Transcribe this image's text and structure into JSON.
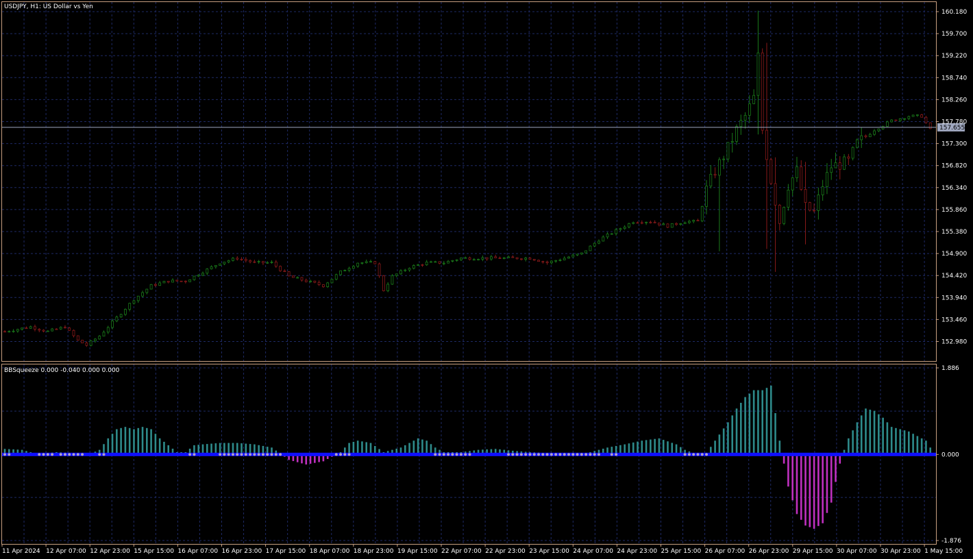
{
  "window": {
    "symbol_title": "USDJPY, H1:  US Dollar vs Yen",
    "indicator_title": "BBSqueeze 0.000 -0.040 0.000 0.000"
  },
  "colors": {
    "background": "#000000",
    "frame": "#c8a080",
    "grid": "#1e2a66",
    "bull": "#1a7a1a",
    "bear": "#8a1a1a",
    "price_line": "#a0a8c0",
    "price_label_bg": "#a0a8c0",
    "hist_pos": "#2e8b8b",
    "hist_neg": "#c030c0",
    "zero_line": "#1010ff",
    "squeeze_dot": "#b0a0c8"
  },
  "chart_data": {
    "type": "candlestick",
    "price_axis": {
      "ticks": [
        "160.180",
        "159.700",
        "159.220",
        "158.740",
        "158.260",
        "157.780",
        "157.300",
        "156.820",
        "156.340",
        "155.860",
        "155.380",
        "154.900",
        "154.420",
        "153.940",
        "153.460",
        "152.980"
      ],
      "range": [
        152.75,
        160.4
      ]
    },
    "current_price": "157.655",
    "time_axis": [
      "11 Apr 2024",
      "12 Apr 07:00",
      "12 Apr 23:00",
      "15 Apr 15:00",
      "16 Apr 07:00",
      "16 Apr 23:00",
      "17 Apr 15:00",
      "18 Apr 07:00",
      "18 Apr 23:00",
      "19 Apr 15:00",
      "22 Apr 07:00",
      "22 Apr 23:00",
      "23 Apr 15:00",
      "24 Apr 07:00",
      "24 Apr 23:00",
      "25 Apr 15:00",
      "26 Apr 07:00",
      "26 Apr 23:00",
      "29 Apr 15:00",
      "30 Apr 07:00",
      "30 Apr 23:00",
      "1 May 15:00"
    ],
    "close_path": [
      [
        0,
        153.2
      ],
      [
        6,
        153.3
      ],
      [
        10,
        153.2
      ],
      [
        14,
        153.3
      ],
      [
        17,
        153.0
      ],
      [
        19,
        152.9
      ],
      [
        22,
        153.1
      ],
      [
        26,
        153.5
      ],
      [
        30,
        153.9
      ],
      [
        34,
        154.2
      ],
      [
        38,
        154.3
      ],
      [
        42,
        154.3
      ],
      [
        46,
        154.5
      ],
      [
        50,
        154.7
      ],
      [
        54,
        154.8
      ],
      [
        58,
        154.7
      ],
      [
        62,
        154.7
      ],
      [
        66,
        154.4
      ],
      [
        70,
        154.3
      ],
      [
        74,
        154.2
      ],
      [
        78,
        154.5
      ],
      [
        82,
        154.7
      ],
      [
        86,
        154.7
      ],
      [
        88,
        154.1
      ],
      [
        90,
        154.4
      ],
      [
        94,
        154.6
      ],
      [
        98,
        154.7
      ],
      [
        102,
        154.7
      ],
      [
        106,
        154.8
      ],
      [
        110,
        154.8
      ],
      [
        114,
        154.8
      ],
      [
        118,
        154.8
      ],
      [
        122,
        154.8
      ],
      [
        126,
        154.7
      ],
      [
        130,
        154.8
      ],
      [
        134,
        154.9
      ],
      [
        138,
        155.2
      ],
      [
        142,
        155.4
      ],
      [
        146,
        155.6
      ],
      [
        150,
        155.6
      ],
      [
        154,
        155.5
      ],
      [
        158,
        155.6
      ],
      [
        161,
        155.6
      ],
      [
        163,
        156.3
      ],
      [
        165,
        156.7
      ],
      [
        168,
        157.2
      ],
      [
        170,
        157.6
      ],
      [
        172,
        157.9
      ],
      [
        174,
        158.3
      ],
      [
        175,
        159.2
      ],
      [
        176,
        157.6
      ],
      [
        178,
        156.5
      ],
      [
        180,
        155.6
      ],
      [
        182,
        156.4
      ],
      [
        184,
        156.7
      ],
      [
        186,
        155.9
      ],
      [
        188,
        155.8
      ],
      [
        190,
        156.4
      ],
      [
        192,
        156.8
      ],
      [
        196,
        156.9
      ],
      [
        198,
        157.3
      ],
      [
        202,
        157.6
      ],
      [
        206,
        157.8
      ],
      [
        210,
        157.9
      ],
      [
        213,
        157.9
      ],
      [
        215,
        157.6
      ]
    ],
    "spikes": [
      [
        166,
        154.95,
        157.0
      ],
      [
        175,
        157.5,
        160.2
      ],
      [
        177,
        155.0,
        159.5
      ],
      [
        179,
        154.5,
        157.0
      ],
      [
        186,
        155.1,
        156.9
      ]
    ],
    "indicator": {
      "axis_ticks": [
        "1.886",
        "0.000",
        "-1.876"
      ],
      "range": [
        -1.876,
        1.886
      ],
      "histogram_path": [
        [
          0,
          0.12
        ],
        [
          4,
          0.1
        ],
        [
          6,
          0.05
        ],
        [
          8,
          0.02
        ],
        [
          10,
          0.03
        ],
        [
          12,
          0.05
        ],
        [
          14,
          0.04
        ],
        [
          17,
          0.03
        ],
        [
          20,
          0.02
        ],
        [
          22,
          0.1
        ],
        [
          24,
          0.35
        ],
        [
          26,
          0.55
        ],
        [
          28,
          0.6
        ],
        [
          30,
          0.55
        ],
        [
          32,
          0.6
        ],
        [
          34,
          0.55
        ],
        [
          36,
          0.35
        ],
        [
          38,
          0.2
        ],
        [
          40,
          0.05
        ],
        [
          42,
          0.05
        ],
        [
          44,
          0.2
        ],
        [
          46,
          0.22
        ],
        [
          50,
          0.25
        ],
        [
          54,
          0.25
        ],
        [
          58,
          0.22
        ],
        [
          62,
          0.15
        ],
        [
          64,
          0.02
        ],
        [
          66,
          -0.12
        ],
        [
          70,
          -0.22
        ],
        [
          74,
          -0.15
        ],
        [
          76,
          -0.05
        ],
        [
          78,
          0.05
        ],
        [
          80,
          0.25
        ],
        [
          82,
          0.3
        ],
        [
          85,
          0.25
        ],
        [
          88,
          0.05
        ],
        [
          92,
          0.15
        ],
        [
          96,
          0.35
        ],
        [
          98,
          0.3
        ],
        [
          100,
          0.15
        ],
        [
          102,
          0.05
        ],
        [
          106,
          0.05
        ],
        [
          110,
          0.1
        ],
        [
          114,
          0.12
        ],
        [
          118,
          0.08
        ],
        [
          122,
          0.05
        ],
        [
          126,
          0.03
        ],
        [
          130,
          0.03
        ],
        [
          134,
          0.02
        ],
        [
          136,
          0.05
        ],
        [
          140,
          0.15
        ],
        [
          144,
          0.22
        ],
        [
          148,
          0.3
        ],
        [
          152,
          0.35
        ],
        [
          156,
          0.22
        ],
        [
          158,
          0.1
        ],
        [
          160,
          0.03
        ],
        [
          163,
          0.03
        ],
        [
          165,
          0.3
        ],
        [
          168,
          0.7
        ],
        [
          170,
          1.0
        ],
        [
          172,
          1.25
        ],
        [
          174,
          1.4
        ],
        [
          176,
          1.4
        ],
        [
          178,
          1.5
        ],
        [
          179,
          0.9
        ],
        [
          180,
          0.3
        ],
        [
          181,
          -0.2
        ],
        [
          182,
          -0.7
        ],
        [
          184,
          -1.3
        ],
        [
          186,
          -1.55
        ],
        [
          188,
          -1.62
        ],
        [
          190,
          -1.5
        ],
        [
          192,
          -1.05
        ],
        [
          193,
          -0.6
        ],
        [
          194,
          -0.2
        ],
        [
          195,
          0.1
        ],
        [
          196,
          0.35
        ],
        [
          198,
          0.7
        ],
        [
          200,
          1.0
        ],
        [
          202,
          0.95
        ],
        [
          204,
          0.8
        ],
        [
          206,
          0.6
        ],
        [
          208,
          0.55
        ],
        [
          210,
          0.5
        ],
        [
          212,
          0.4
        ],
        [
          214,
          0.3
        ],
        [
          215,
          0.15
        ]
      ],
      "squeeze_dot_ranges": [
        [
          0,
          1
        ],
        [
          8,
          11
        ],
        [
          13,
          16
        ],
        [
          17,
          18
        ],
        [
          22,
          23
        ],
        [
          43,
          44
        ],
        [
          50,
          64
        ],
        [
          77,
          80
        ],
        [
          100,
          108
        ],
        [
          117,
          136
        ],
        [
          137,
          138
        ],
        [
          141,
          142
        ],
        [
          158,
          163
        ]
      ]
    }
  }
}
